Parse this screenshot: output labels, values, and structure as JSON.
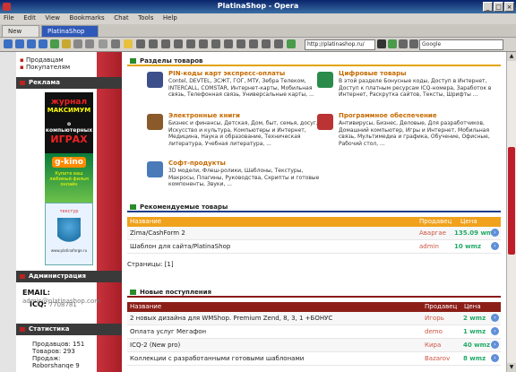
{
  "window": {
    "title": "PlatinaShop - Opera"
  },
  "menu": [
    "File",
    "Edit",
    "View",
    "Bookmarks",
    "Chat",
    "Tools",
    "Help"
  ],
  "tabs": [
    {
      "label": "New tab"
    },
    {
      "label": "PlatinaShop"
    }
  ],
  "address": {
    "value": "http://platinashop.ru/"
  },
  "search": {
    "placeholder": "Google"
  },
  "sidebar": {
    "links": [
      "Продавцам",
      "Покупателям"
    ],
    "ads_title": "Реклама",
    "ad1": {
      "line1": "журнал",
      "line2": "МАКСИМУМ",
      "line3": "о компьютерных",
      "line4": "ИГРАХ"
    },
    "ad2": {
      "logo": "g-kino",
      "text": "Купите ваш любимый фильм онлайн"
    },
    "ad3": {
      "title": "текстур",
      "url": "www.platinaforge.ru"
    },
    "admin_title": "Администрация",
    "email_label": "EMAIL:",
    "email_value": "admin@platinashop.com",
    "icq_label": "ICQ:",
    "icq_value": "7708781",
    "stats_title": "Статистика",
    "stats": [
      "Продавцов: 151",
      "Товаров: 293",
      "Продаж:",
      "Roborshanqe 9"
    ]
  },
  "main": {
    "sections_title": "Разделы товаров",
    "categories": [
      {
        "title": "PIN-коды карт экспресс-оплаты",
        "desc": "Contel, DEVTEL, ЗСЖТ, ГОГ, МТУ, Зебра Телеком, INTERCALL, COMSTAR, Интернет-карты, Мобильная связь, Телефонная связь, Универсальные карты, ..."
      },
      {
        "title": "Цифровые товары",
        "desc": "В этой разделе Бонусные коды, Доступ в Интернет, Доступ к платным ресурсам ICQ-номера, Заработок в Интернет, Раскрутка сайтов, Тексты, Шрифты ..."
      },
      {
        "title": "Электронные книги",
        "desc": "Бизнес и финансы, Детская, Дом, быт, семья, досуг, Искусство и культура, Компьютеры и Интернет, Медицина, Наука и образование, Техническая литература, Учебная литература, ..."
      },
      {
        "title": "Программное обеспечение",
        "desc": "Антивирусы, Бизнес, Деловые, Для разработчиков, Домашний компьютер, Игры и Интернет, Мобильная связь, Мультимедиа и графика, Обучение, Офисные, Рабочий стол, ..."
      },
      {
        "title": "Софт-продукты",
        "desc": "3D модели, Флеш-ролики, Шаблоны, Текстуры, Макросы, Плагины, Руководства, Скрипты и готовые компоненты, Звуки, ..."
      }
    ],
    "recommended_title": "Рекомендуемые товары",
    "recommended_headers": {
      "name": "Название",
      "seller": "Продавец",
      "price": "Цена"
    },
    "recommended": [
      {
        "name": "Zima/CashForm 2",
        "seller": "Аваргае",
        "price": "135.09 wmz"
      },
      {
        "name": "Шаблон для сайта/PlatinaShop",
        "seller": "admin",
        "price": "10 wmz"
      }
    ],
    "pages_label": "Страницы: [1]",
    "new_title": "Новые поступления",
    "new_headers": {
      "name": "Название",
      "seller": "Продавец",
      "price": "Цена"
    },
    "new_items": [
      {
        "name": "2 новых дизайна для WMShop. Premium Zend, 8, 3, 1 +БОНУС",
        "seller": "Игорь",
        "price": "2 wmz"
      },
      {
        "name": "Оплата услуг Мегафон",
        "seller": "demo",
        "price": "1 wmz"
      },
      {
        "name": "ICQ-2 (New pro)",
        "seller": "Кира",
        "price": "40 wmz"
      },
      {
        "name": "Коллекции с разработанными готовыми шаблонами",
        "seller": "Bazarov",
        "price": "8 wmz"
      }
    ]
  }
}
